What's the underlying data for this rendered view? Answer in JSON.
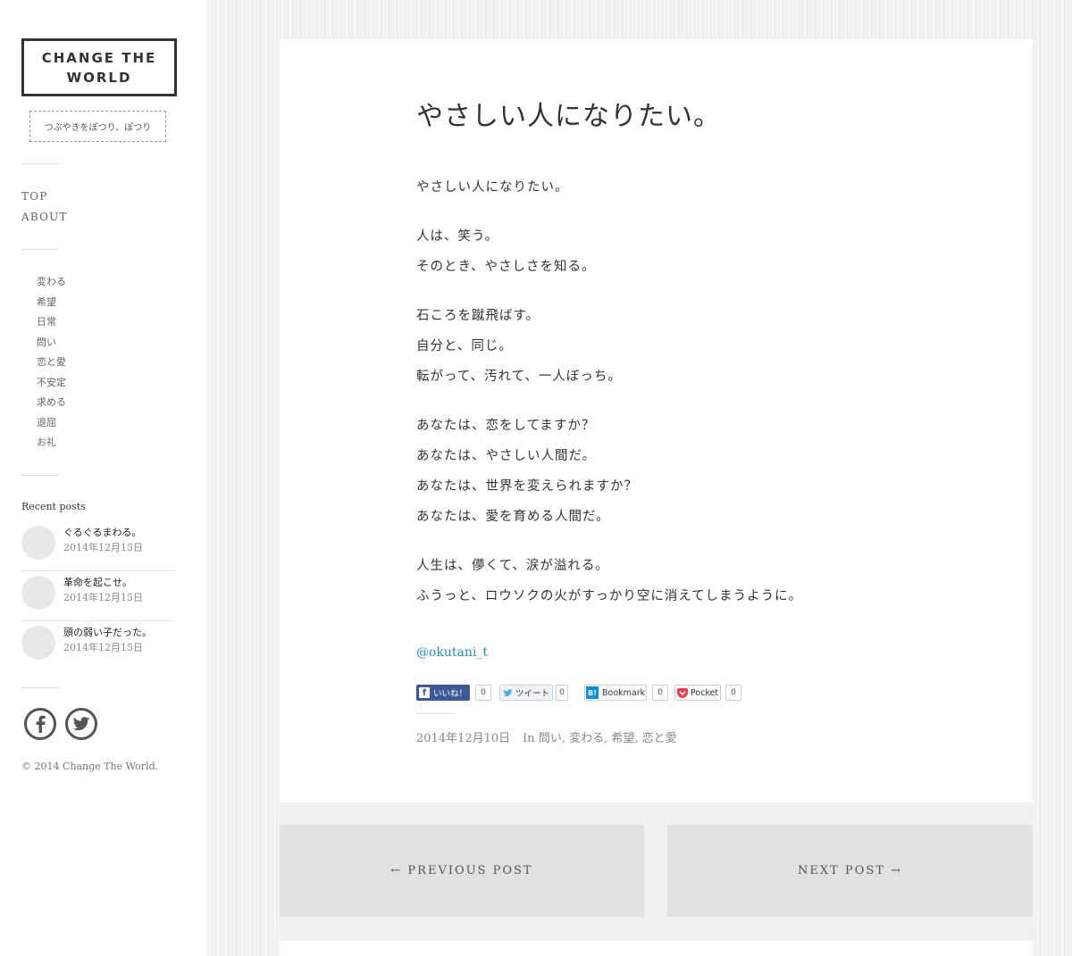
{
  "site": {
    "title": "CHANGE THE WORLD",
    "tagline": "つぶやきをぽつり、ぽつり"
  },
  "main_nav": [
    {
      "label": "TOP"
    },
    {
      "label": "ABOUT"
    }
  ],
  "categories": [
    {
      "label": "変わる"
    },
    {
      "label": "希望"
    },
    {
      "label": "日常"
    },
    {
      "label": "問い"
    },
    {
      "label": "恋と愛"
    },
    {
      "label": "不安定"
    },
    {
      "label": "求める"
    },
    {
      "label": "退屈"
    },
    {
      "label": "お礼"
    }
  ],
  "recent_posts": {
    "heading": "Recent posts",
    "items": [
      {
        "title": "ぐるぐるまわる。",
        "date": "2014年12月15日"
      },
      {
        "title": "革命を起こせ。",
        "date": "2014年12月15日"
      },
      {
        "title": "頭の弱い子だった。",
        "date": "2014年12月15日"
      }
    ]
  },
  "social": {
    "facebook_icon": "facebook-icon",
    "twitter_icon": "twitter-icon"
  },
  "copyright": "© 2014 Change The World.",
  "post": {
    "title": "やさしい人になりたい。",
    "stanzas": [
      [
        "やさしい人になりたい。"
      ],
      [
        "人は、笑う。",
        "そのとき、やさしさを知る。"
      ],
      [
        "石ころを蹴飛ばす。",
        "自分と、同じ。",
        "転がって、汚れて、一人ぼっち。"
      ],
      [
        "あなたは、恋をしてますか？",
        "あなたは、やさしい人間だ。",
        "あなたは、世界を変えられますか？",
        "あなたは、愛を育める人間だ。"
      ],
      [
        "人生は、儚くて、涙が溢れる。",
        "ふうっと、ロウソクの火がすっかり空に消えてしまうように。"
      ]
    ],
    "author_handle": "@okutani_t",
    "date": "2014年12月10日",
    "categories_prefix": "In",
    "categories_text": "問い, 変わる, 希望, 恋と愛"
  },
  "share": {
    "facebook": {
      "label": "いいね！",
      "count": "0"
    },
    "twitter": {
      "label": "ツイート",
      "count": "0"
    },
    "hatena": {
      "label": "Bookmark",
      "count": "0"
    },
    "pocket": {
      "label": "Pocket",
      "count": "0"
    }
  },
  "pagination": {
    "prev": "← PREVIOUS POST",
    "next": "NEXT POST →"
  },
  "colors": {
    "link": "#2b8bb8",
    "facebook": "#3b5998",
    "twitter": "#55acee",
    "hatena": "#008fde",
    "pocket": "#ee4056"
  }
}
